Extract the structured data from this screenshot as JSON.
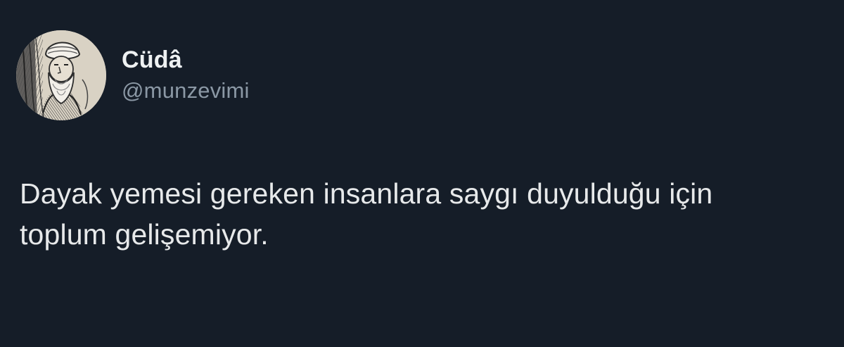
{
  "tweet": {
    "author": {
      "display_name": "Cüdâ",
      "handle": "@munzevimi",
      "avatar": "engraved-portrait-bearded-man-with-turban"
    },
    "text_lines": [
      "Dayak yemesi gereken insanlara saygı duyulduğu için",
      "toplum gelişemiyor."
    ]
  },
  "theme": {
    "background": "#151d28",
    "text": "#e7e9ea",
    "secondary_text": "#8b98a5"
  }
}
